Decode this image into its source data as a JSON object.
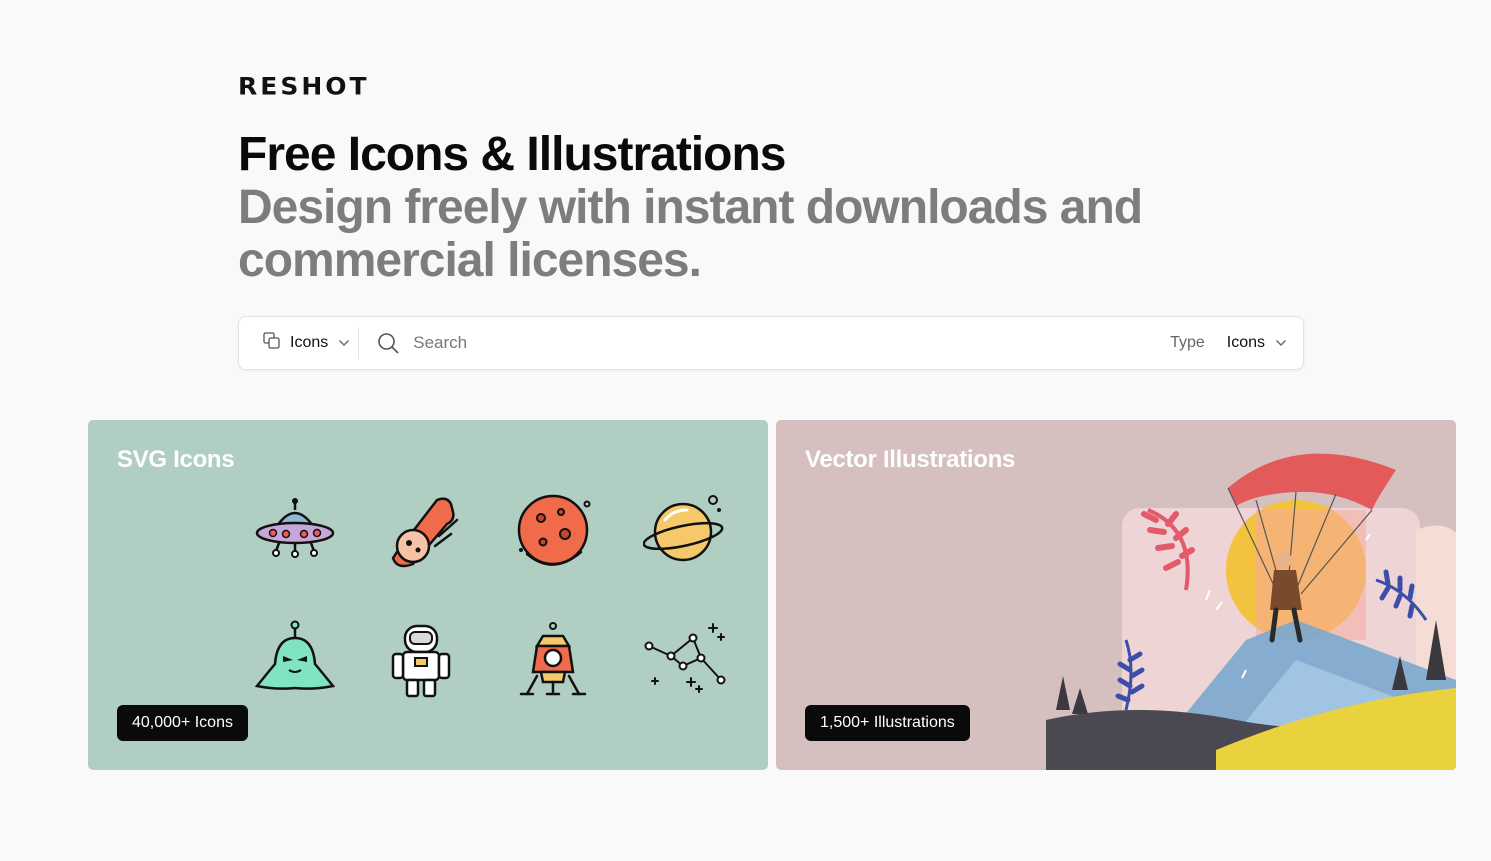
{
  "brand": {
    "logo_text": "RESHOT"
  },
  "hero": {
    "title": "Free Icons & Illustrations",
    "subtitle": "Design freely with instant downloads and commercial licenses."
  },
  "search": {
    "asset_type": "Icons",
    "placeholder": "Search",
    "type_label": "Type",
    "type_value": "Icons"
  },
  "cards": [
    {
      "title": "SVG Icons",
      "badge": "40,000+ Icons",
      "color": "#b0cfc2",
      "icons": [
        "ufo-icon",
        "meteor-icon",
        "mars-icon",
        "saturn-icon",
        "alien-icon",
        "astronaut-icon",
        "lunar-lander-icon",
        "constellation-icon"
      ]
    },
    {
      "title": "Vector Illustrations",
      "badge": "1,500+ Illustrations",
      "color": "#d5bfbf"
    }
  ],
  "icons": {
    "asset": "layers-icon",
    "chevron": "chevron-down-icon",
    "search": "search-icon"
  }
}
